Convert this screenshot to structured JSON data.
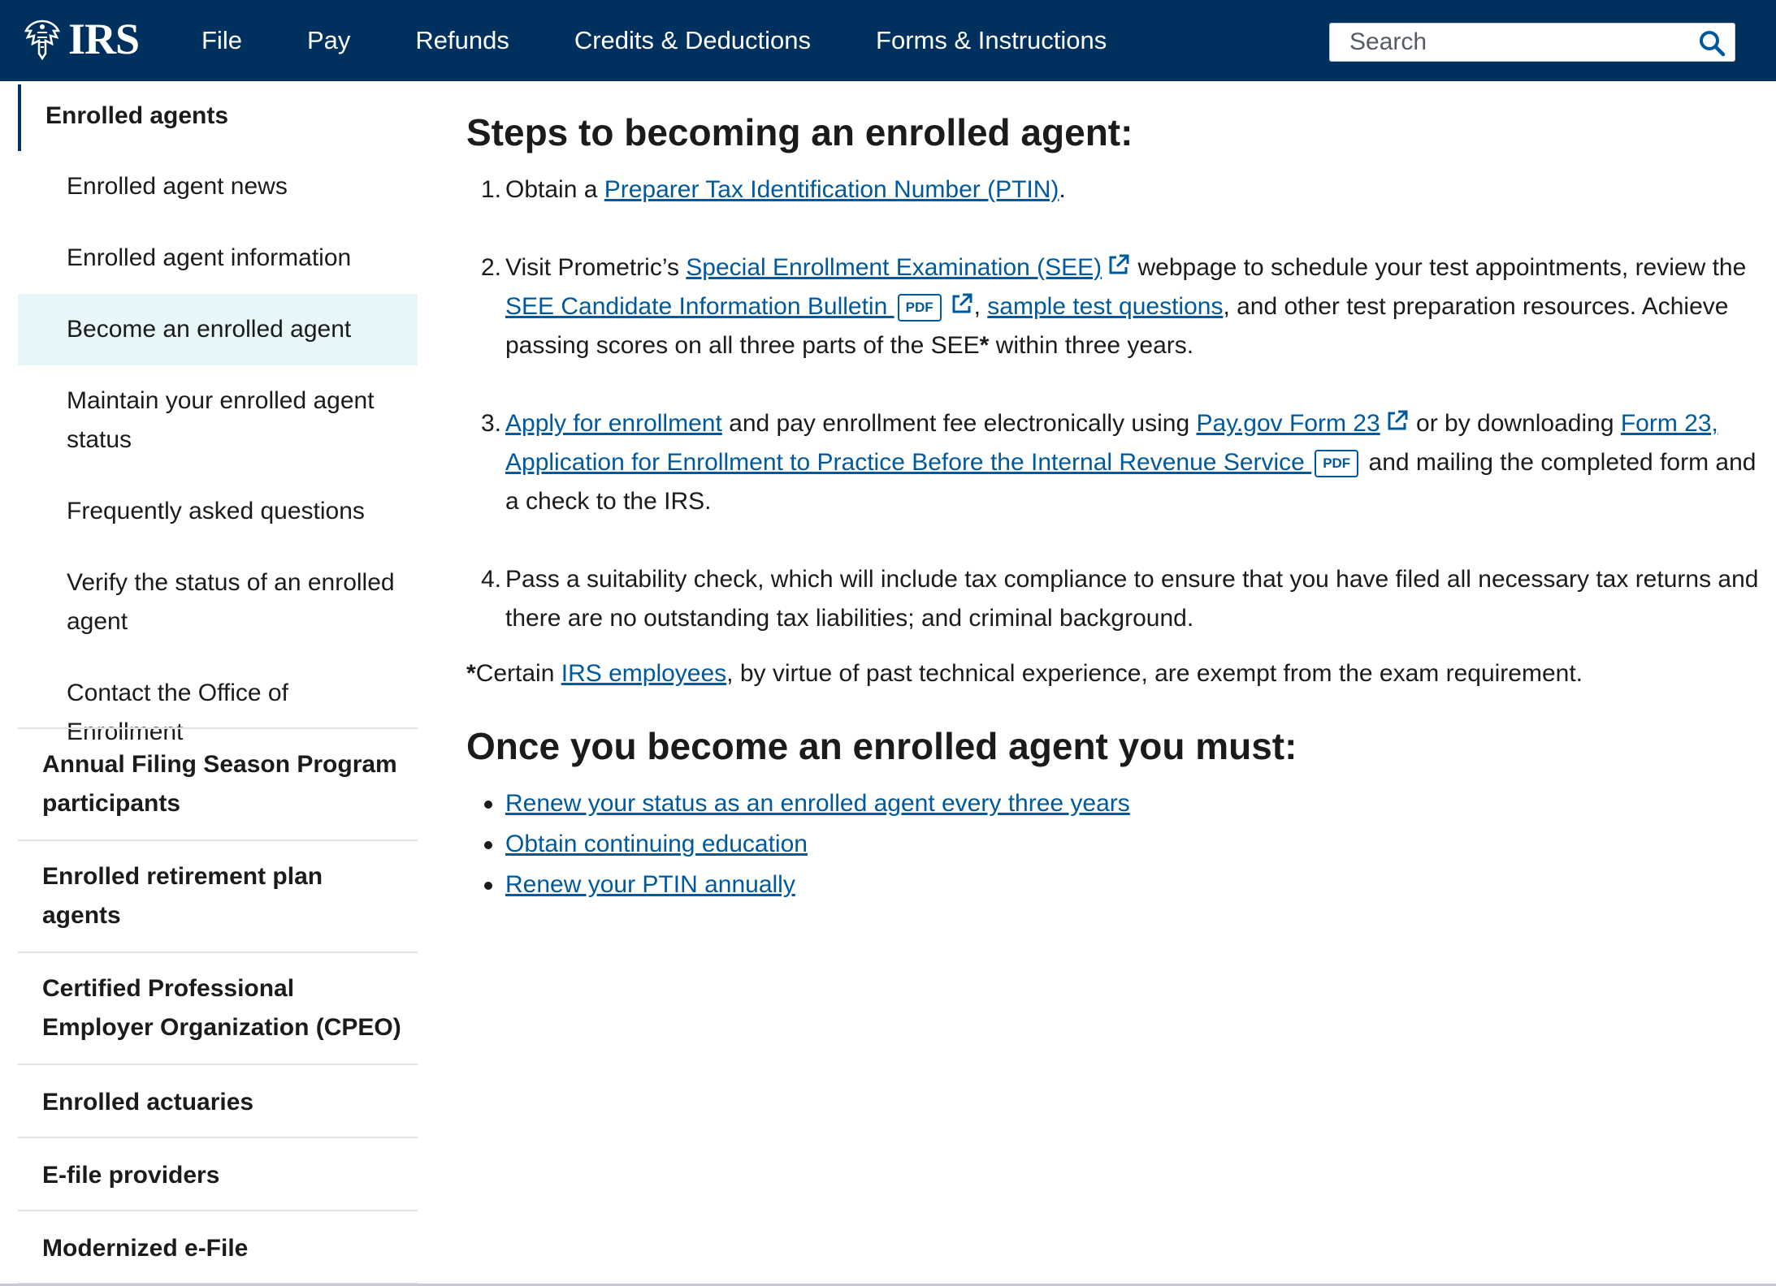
{
  "header": {
    "logo_text": "IRS",
    "nav": [
      "File",
      "Pay",
      "Refunds",
      "Credits & Deductions",
      "Forms & Instructions"
    ],
    "search_placeholder": "Search",
    "colors": {
      "bar": "#00305e",
      "link": "#00599c",
      "active_bg": "#e7f6f8"
    }
  },
  "sidebar": {
    "heading": "Enrolled agents",
    "sub_items": [
      {
        "label": "Enrolled agent news"
      },
      {
        "label": "Enrolled agent information"
      },
      {
        "label": "Become an enrolled agent",
        "active": true
      },
      {
        "label": "Maintain your enrolled agent status"
      },
      {
        "label": "Frequently asked questions"
      },
      {
        "label": "Verify the status of an enrolled agent"
      },
      {
        "label": "Contact the Office of Enrollment"
      }
    ],
    "top_items": [
      "Annual Filing Season Program participants",
      "Enrolled retirement plan agents",
      "Certified Professional Employer Organization (CPEO)",
      "Enrolled actuaries",
      "E-file providers",
      "Modernized e-File"
    ]
  },
  "main": {
    "heading1": "Steps to becoming an enrolled agent:",
    "pdf_badge": "PDF",
    "step1": {
      "num": "1.",
      "pre": "Obtain a ",
      "link": "Preparer Tax Identification Number (PTIN)",
      "post": "."
    },
    "step2": {
      "num": "2.",
      "pre": "Visit Prometric’s ",
      "link1": "Special Enrollment Examination (SEE)",
      "mid1": " webpage to schedule your test appointments, review the ",
      "link2": "SEE Candidate Information Bulletin ",
      "mid2": ", ",
      "link3": "sample test questions",
      "mid3": ", and other test preparation resources. Achieve passing scores on all three parts of the SEE",
      "star": "*",
      "post": " within three years."
    },
    "step3": {
      "num": "3.",
      "link1": "Apply for enrollment",
      "mid1": " and pay enrollment fee electronically using ",
      "link2": "Pay.gov Form 23",
      "mid2": " or by downloading ",
      "link3": "Form 23, Application for Enrollment to Practice Before the Internal Revenue Service ",
      "post": " and mailing the completed form and a check to the IRS."
    },
    "step4": {
      "num": "4.",
      "text": "Pass a suitability check, which will include tax compliance to ensure that you have filed all necessary tax returns and there are no outstanding tax liabilities; and criminal background."
    },
    "note": {
      "star": "*",
      "pre": "Certain ",
      "link": "IRS employees",
      "post": ", by virtue of past technical experience, are exempt from the exam requirement."
    },
    "heading2": "Once you become an enrolled agent you must:",
    "bullets": [
      "Renew your status as an enrolled agent every three years",
      "Obtain continuing education",
      "Renew your PTIN annually"
    ]
  }
}
